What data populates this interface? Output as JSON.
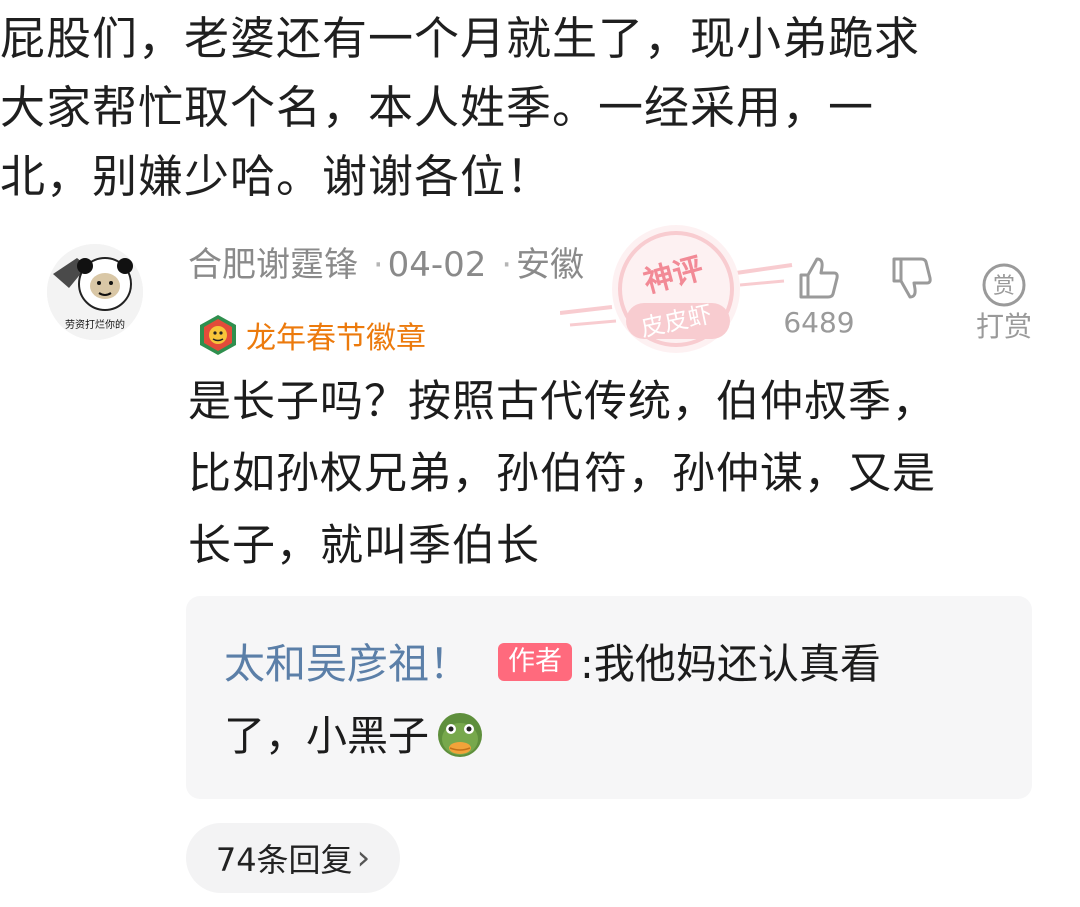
{
  "post": {
    "lines": [
      "屁股们，老婆还有一个月就生了，现小弟跪求",
      "大家帮忙取个名，本人姓季。一经采用，一",
      "北，别嫌少哈。谢谢各位！"
    ]
  },
  "comment": {
    "avatar_caption": "劳资打烂你的",
    "user": "合肥谢霆锋",
    "date": "04-02",
    "location": "安徽",
    "separator": "·",
    "medal": "龙年春节徽章",
    "stamp_top": "神评",
    "stamp_bottom": "皮皮虾",
    "likes": "6489",
    "tip_icon_char": "赏",
    "tip_label": "打赏",
    "text_lines": [
      "是长子吗？按照古代传统，伯仲叔季，",
      "比如孙权兄弟，孙伯符，孙仲谋，又是",
      "长子，就叫季伯长"
    ]
  },
  "reply": {
    "author": "太和吴彦祖！",
    "author_tag": "作者",
    "text_part1": ":我他妈还认真看",
    "text_part2": "了，小黑子"
  },
  "more_replies": {
    "label": "74条回复",
    "chevron": "›"
  },
  "colors": {
    "medal_text": "#ec7a0c",
    "reply_author": "#5b7fa8",
    "author_tag_bg": "#ff6a7d",
    "stamp": "#f4a3ab"
  },
  "icons": {
    "like": "thumbs-up-icon",
    "dislike": "thumbs-down-icon",
    "tip": "tip-coin-icon",
    "medal": "dragon-medal-icon",
    "emoji": "chicken-face-emoji"
  }
}
